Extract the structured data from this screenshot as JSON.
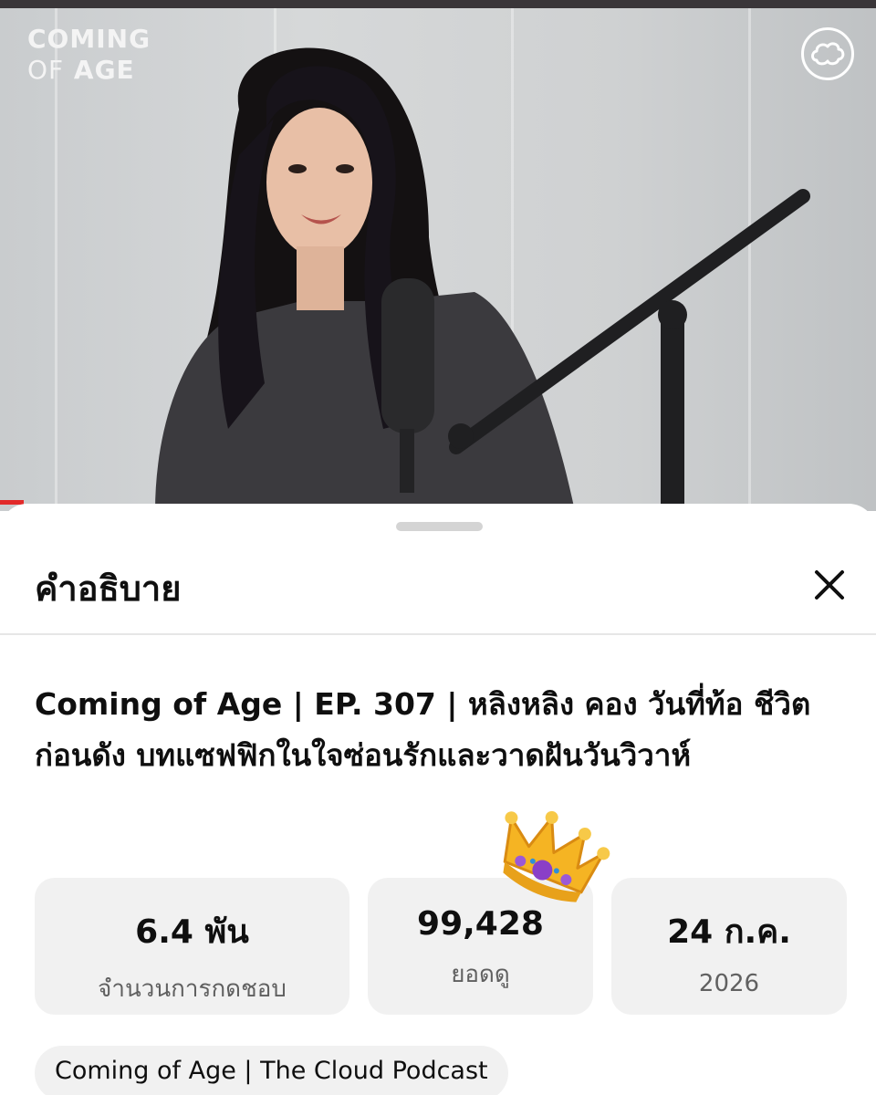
{
  "video": {
    "brand_line1": "COMING",
    "brand_line2_a": "OF",
    "brand_line2_b": "AGE",
    "badge_icon": "cloud-icon"
  },
  "sheet": {
    "title": "คำอธิบาย",
    "close_icon": "close-icon"
  },
  "video_title": "Coming of Age | EP. 307 | หลิงหลิง คอง วันที่ท้อ ชีวิตก่อนดัง บทแซฟฟิกในใจซ่อนรักและวาดฝันวันวิวาห์",
  "stats": {
    "likes": {
      "value": "6.4 พัน",
      "label": "จำนวนการกดชอบ"
    },
    "views": {
      "value": "99,428",
      "label": "ยอดดู"
    },
    "date": {
      "value": "24 ก.ค.",
      "label": "2026"
    }
  },
  "sticker": "crown-emoji",
  "channel_chip": "Coming of Age | The Cloud Podcast",
  "colors": {
    "accent_red": "#e22a2a",
    "chip_bg": "#f1f1f1",
    "text_primary": "#0f0f0f",
    "text_secondary": "#606060"
  }
}
